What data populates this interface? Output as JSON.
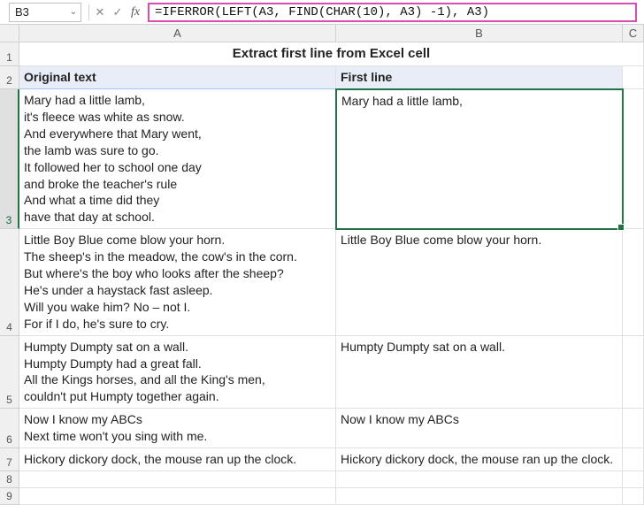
{
  "formula_bar": {
    "cell_ref": "B3",
    "formula": "=IFERROR(LEFT(A3, FIND(CHAR(10), A3) -1), A3)"
  },
  "columns": {
    "a": "A",
    "b": "B",
    "c": "C"
  },
  "title": "Extract first line from Excel cell",
  "headers": {
    "col1": "Original text",
    "col2": "First line"
  },
  "rows": [
    {
      "num": "3",
      "original": "Mary had a little lamb,\nit's fleece was white as snow.\nAnd everywhere that Mary went,\nthe lamb was sure to go.\nIt followed her to school one day\nand broke the teacher's rule\nAnd what a time did they\nhave that day at school.",
      "first": "Mary had a little lamb,"
    },
    {
      "num": "4",
      "original": "Little Boy Blue come blow your horn.\nThe sheep's in the meadow, the cow's in the corn.\nBut where's the boy who looks after the sheep?\nHe's under a haystack fast asleep.\nWill you wake him? No – not I.\nFor if I do, he's sure to cry.",
      "first": "Little Boy Blue come blow your horn."
    },
    {
      "num": "5",
      "original": "Humpty Dumpty sat on a wall.\nHumpty Dumpty had a great fall.\nAll the Kings horses, and all the King's men,\ncouldn't put Humpty together again.",
      "first": "Humpty Dumpty sat on a wall."
    },
    {
      "num": "6",
      "original": "Now I know my ABCs\nNext time won't you sing with me.",
      "first": "Now I know my ABCs"
    },
    {
      "num": "7",
      "original": "Hickory dickory dock, the mouse ran up the clock.",
      "first": "Hickory dickory dock, the mouse ran up the clock."
    }
  ],
  "row_labels": {
    "r1": "1",
    "r2": "2",
    "r8": "8",
    "r9": "9"
  },
  "icons": {
    "cancel": "✕",
    "accept": "✓",
    "fx": "fx",
    "chev": "⌄"
  }
}
